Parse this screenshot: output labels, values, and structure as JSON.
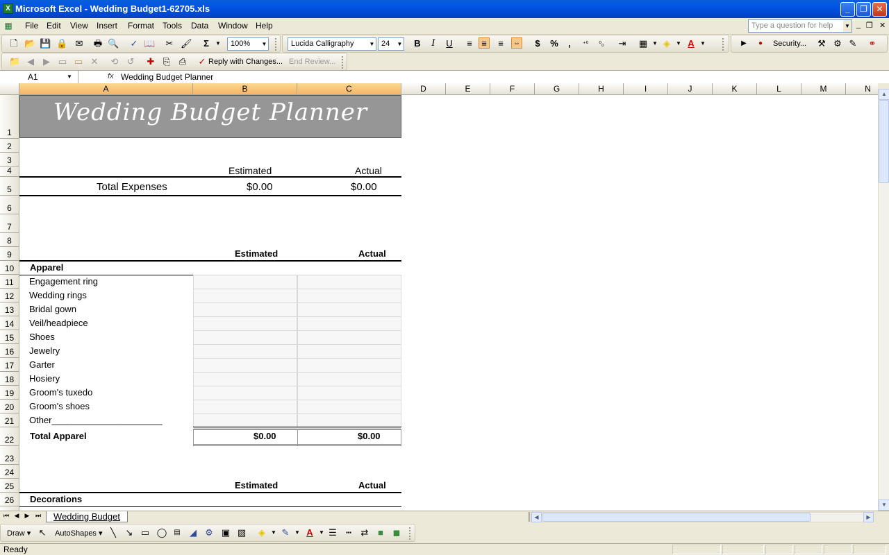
{
  "window": {
    "title": "Microsoft Excel - Wedding Budget1-62705.xls"
  },
  "menu": [
    "File",
    "Edit",
    "View",
    "Insert",
    "Format",
    "Tools",
    "Data",
    "Window",
    "Help"
  ],
  "help_placeholder": "Type a question for help",
  "toolbar": {
    "zoom": "100%",
    "font_name": "Lucida Calligraphy",
    "font_size": "24",
    "bold": "B",
    "italic": "I",
    "underline": "U",
    "currency": "$",
    "percent": "%",
    "comma": ",",
    "security": "Security...",
    "reply_with_changes": "Reply with Changes...",
    "end_review": "End Review..."
  },
  "formula_bar": {
    "name_box": "A1",
    "fx": "fx",
    "content": "Wedding Budget Planner"
  },
  "columns": [
    "A",
    "B",
    "C",
    "D",
    "E",
    "F",
    "G",
    "H",
    "I",
    "J",
    "K",
    "L",
    "M",
    "N"
  ],
  "rows": [
    "1",
    "2",
    "3",
    "4",
    "5",
    "6",
    "7",
    "8",
    "9",
    "10",
    "11",
    "12",
    "13",
    "14",
    "15",
    "16",
    "17",
    "18",
    "19",
    "20",
    "21",
    "22",
    "23",
    "24",
    "25",
    "26"
  ],
  "sheet": {
    "title": "Wedding Budget Planner",
    "summary": {
      "estimated_header": "Estimated",
      "actual_header": "Actual",
      "total_label": "Total Expenses",
      "total_estimated": "$0.00",
      "total_actual": "$0.00"
    },
    "apparel": {
      "estimated_header": "Estimated",
      "actual_header": "Actual",
      "heading": "Apparel",
      "items": [
        "Engagement ring",
        "Wedding rings",
        "Bridal gown",
        "Veil/headpiece",
        "Shoes",
        "Jewelry",
        "Garter",
        "Hosiery",
        "Groom's tuxedo",
        "Groom's shoes",
        "Other______________________"
      ],
      "total_label": "Total Apparel",
      "total_estimated": "$0.00",
      "total_actual": "$0.00"
    },
    "decorations": {
      "estimated_header": "Estimated",
      "actual_header": "Actual",
      "heading": "Decorations"
    }
  },
  "sheet_tab": "Wedding Budget",
  "drawing": {
    "draw": "Draw",
    "autoshapes": "AutoShapes"
  },
  "status": "Ready"
}
